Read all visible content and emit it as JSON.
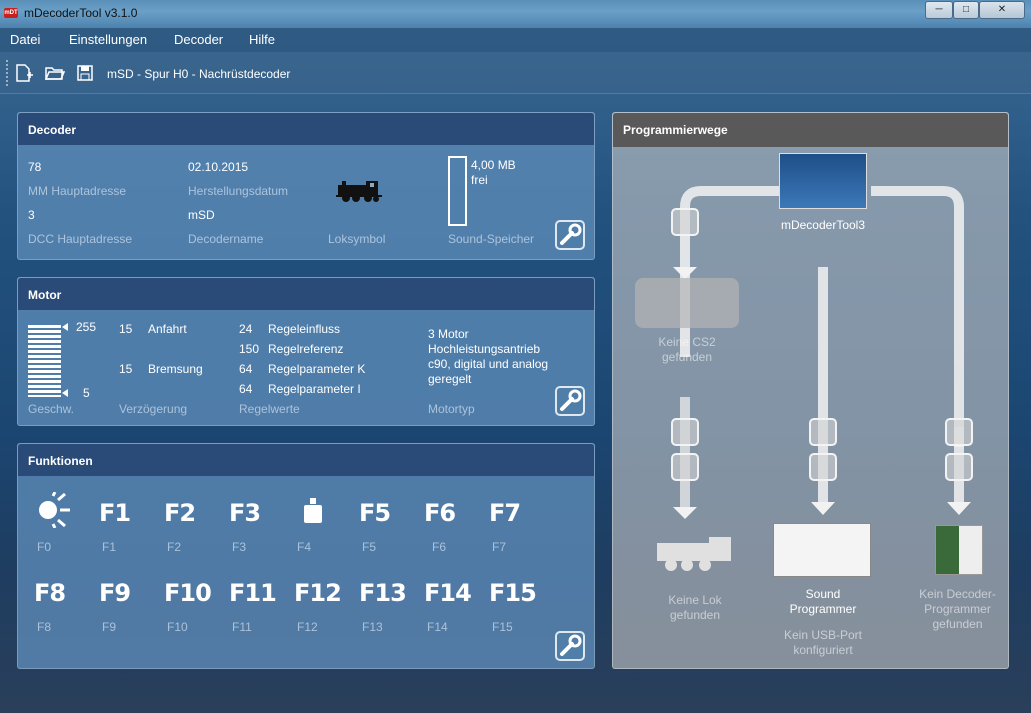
{
  "window": {
    "title": "mDecoderTool v3.1.0",
    "app_icon": "mDT",
    "controls": {
      "minimize": "─",
      "maximize": "□",
      "close": "✕"
    }
  },
  "menu": [
    "Datei",
    "Einstellungen",
    "Decoder",
    "Hilfe"
  ],
  "toolbar": {
    "caption": "mSD - Spur H0 - Nachrüstdecoder",
    "icons": [
      "new-file-icon",
      "open-folder-icon",
      "save-icon"
    ]
  },
  "decoder": {
    "title": "Decoder",
    "mm_value": "78",
    "mm_label": "MM Hauptadresse",
    "dcc_value": "3",
    "dcc_label": "DCC Hauptadresse",
    "date_value": "02.10.2015",
    "date_label": "Herstellungsdatum",
    "name_value": "mSD",
    "name_label": "Decodername",
    "loco_label": "Loksymbol",
    "sound_value": "4,00 MB",
    "sound_free": "frei",
    "sound_label": "Sound-Speicher",
    "sound_used_fraction": 0
  },
  "motor": {
    "title": "Motor",
    "speed_max": "255",
    "speed_min": "5",
    "speed_label": "Geschw.",
    "delay_label": "Verzögerung",
    "delays": [
      {
        "value": "15",
        "name": "Anfahrt"
      },
      {
        "value": "15",
        "name": "Bremsung"
      }
    ],
    "reg_label": "Regelwerte",
    "regs": [
      {
        "value": "24",
        "name": "Regeleinfluss"
      },
      {
        "value": "150",
        "name": "Regelreferenz"
      },
      {
        "value": "64",
        "name": "Regelparameter K"
      },
      {
        "value": "64",
        "name": "Regelparameter I"
      }
    ],
    "motortype_label": "Motortyp",
    "motortype_lines": [
      "3 Motor",
      "Hochleistungsantrieb",
      "c90, digital und analog",
      "geregelt"
    ]
  },
  "functions": {
    "title": "Funktionen",
    "row1": [
      {
        "key": "",
        "label": "F0",
        "icon": "light-icon"
      },
      {
        "key": "F1",
        "label": "F1"
      },
      {
        "key": "F2",
        "label": "F2"
      },
      {
        "key": "F3",
        "label": "F3"
      },
      {
        "key": "",
        "label": "F4",
        "icon": "weight-icon"
      },
      {
        "key": "F5",
        "label": "F5"
      },
      {
        "key": "F6",
        "label": "F6"
      },
      {
        "key": "F7",
        "label": "F7"
      }
    ],
    "row2": [
      {
        "key": "F8",
        "label": "F8"
      },
      {
        "key": "F9",
        "label": "F9"
      },
      {
        "key": "F10",
        "label": "F10"
      },
      {
        "key": "F11",
        "label": "F11"
      },
      {
        "key": "F12",
        "label": "F12"
      },
      {
        "key": "F13",
        "label": "F13"
      },
      {
        "key": "F14",
        "label": "F14"
      },
      {
        "key": "F15",
        "label": "F15"
      }
    ]
  },
  "prog": {
    "title": "Programmierwege",
    "tool": "mDecoderTool3",
    "cs2": [
      "Keine CS2",
      "gefunden"
    ],
    "lok": [
      "Keine Lok",
      "gefunden"
    ],
    "sound": [
      "Sound",
      "Programmer"
    ],
    "usb": [
      "Kein USB-Port",
      "konfiguriert"
    ],
    "decprog": [
      "Kein Decoder-",
      "Programmer",
      "gefunden"
    ]
  }
}
